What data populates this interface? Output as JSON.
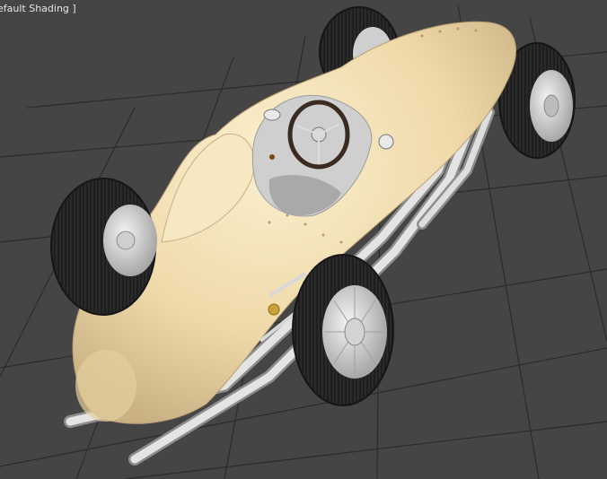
{
  "viewport": {
    "label": "efault Shading ]",
    "background_color": "#454545",
    "grid_color": "#2a2a2a",
    "model": {
      "name": "race-car",
      "body_color": "#f1ddb0",
      "tire_color": "#262626",
      "wheel_color": "#dcdcdc",
      "exhaust_color": "#e0e0e0"
    }
  }
}
